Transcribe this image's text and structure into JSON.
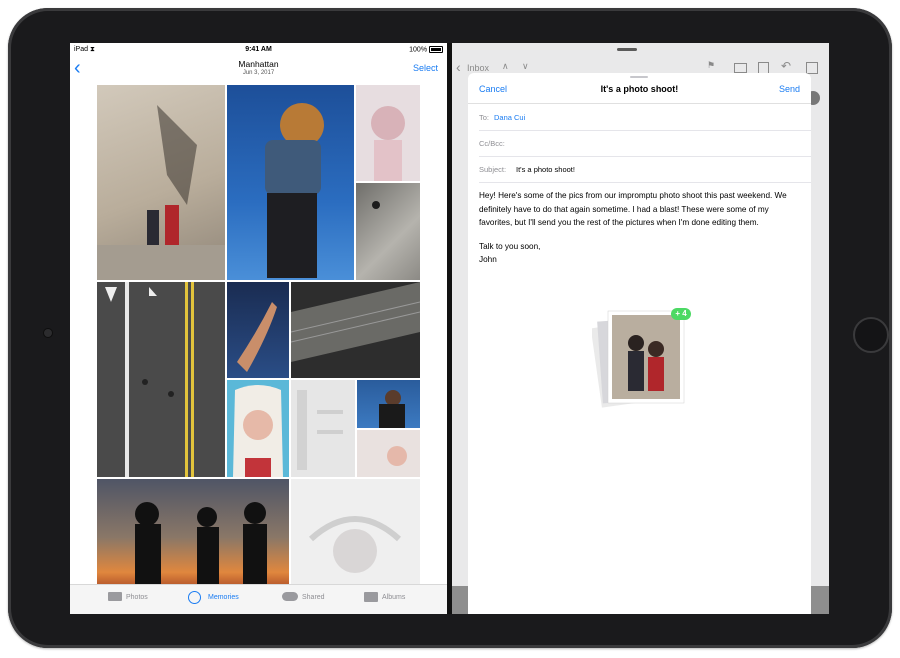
{
  "status_bar": {
    "device": "iPad",
    "time": "9:41 AM",
    "battery": "100%"
  },
  "photos": {
    "back_icon": "chevron-left-icon",
    "title": "Manhattan",
    "subtitle": "Jun 3, 2017",
    "select_label": "Select",
    "tabs": [
      {
        "label": "Photos",
        "icon": "photos-icon",
        "active": false
      },
      {
        "label": "Memories",
        "icon": "memories-icon",
        "active": true
      },
      {
        "label": "Shared",
        "icon": "cloud-icon",
        "active": false
      },
      {
        "label": "Albums",
        "icon": "albums-icon",
        "active": false
      }
    ]
  },
  "mail_background": {
    "inbox_label": "Inbox"
  },
  "compose": {
    "cancel_label": "Cancel",
    "title": "It's a photo shoot!",
    "send_label": "Send",
    "to_label": "To:",
    "to_value": "Dana Cui",
    "ccbcc_label": "Cc/Bcc:",
    "subject_label": "Subject:",
    "subject_value": "It's a photo shoot!",
    "body": {
      "p1": "Hey! Here's some of the pics from our impromptu photo shoot this past weekend. We definitely have to do that again sometime. I had a blast! These were some of my favorites, but I'll send you the rest of the pictures when I'm done editing them.",
      "p2": "Talk to you soon,",
      "p3": "John"
    },
    "drag_badge": "+ 4"
  },
  "colors": {
    "accent": "#1a7cf2",
    "badge": "#4cd964"
  }
}
